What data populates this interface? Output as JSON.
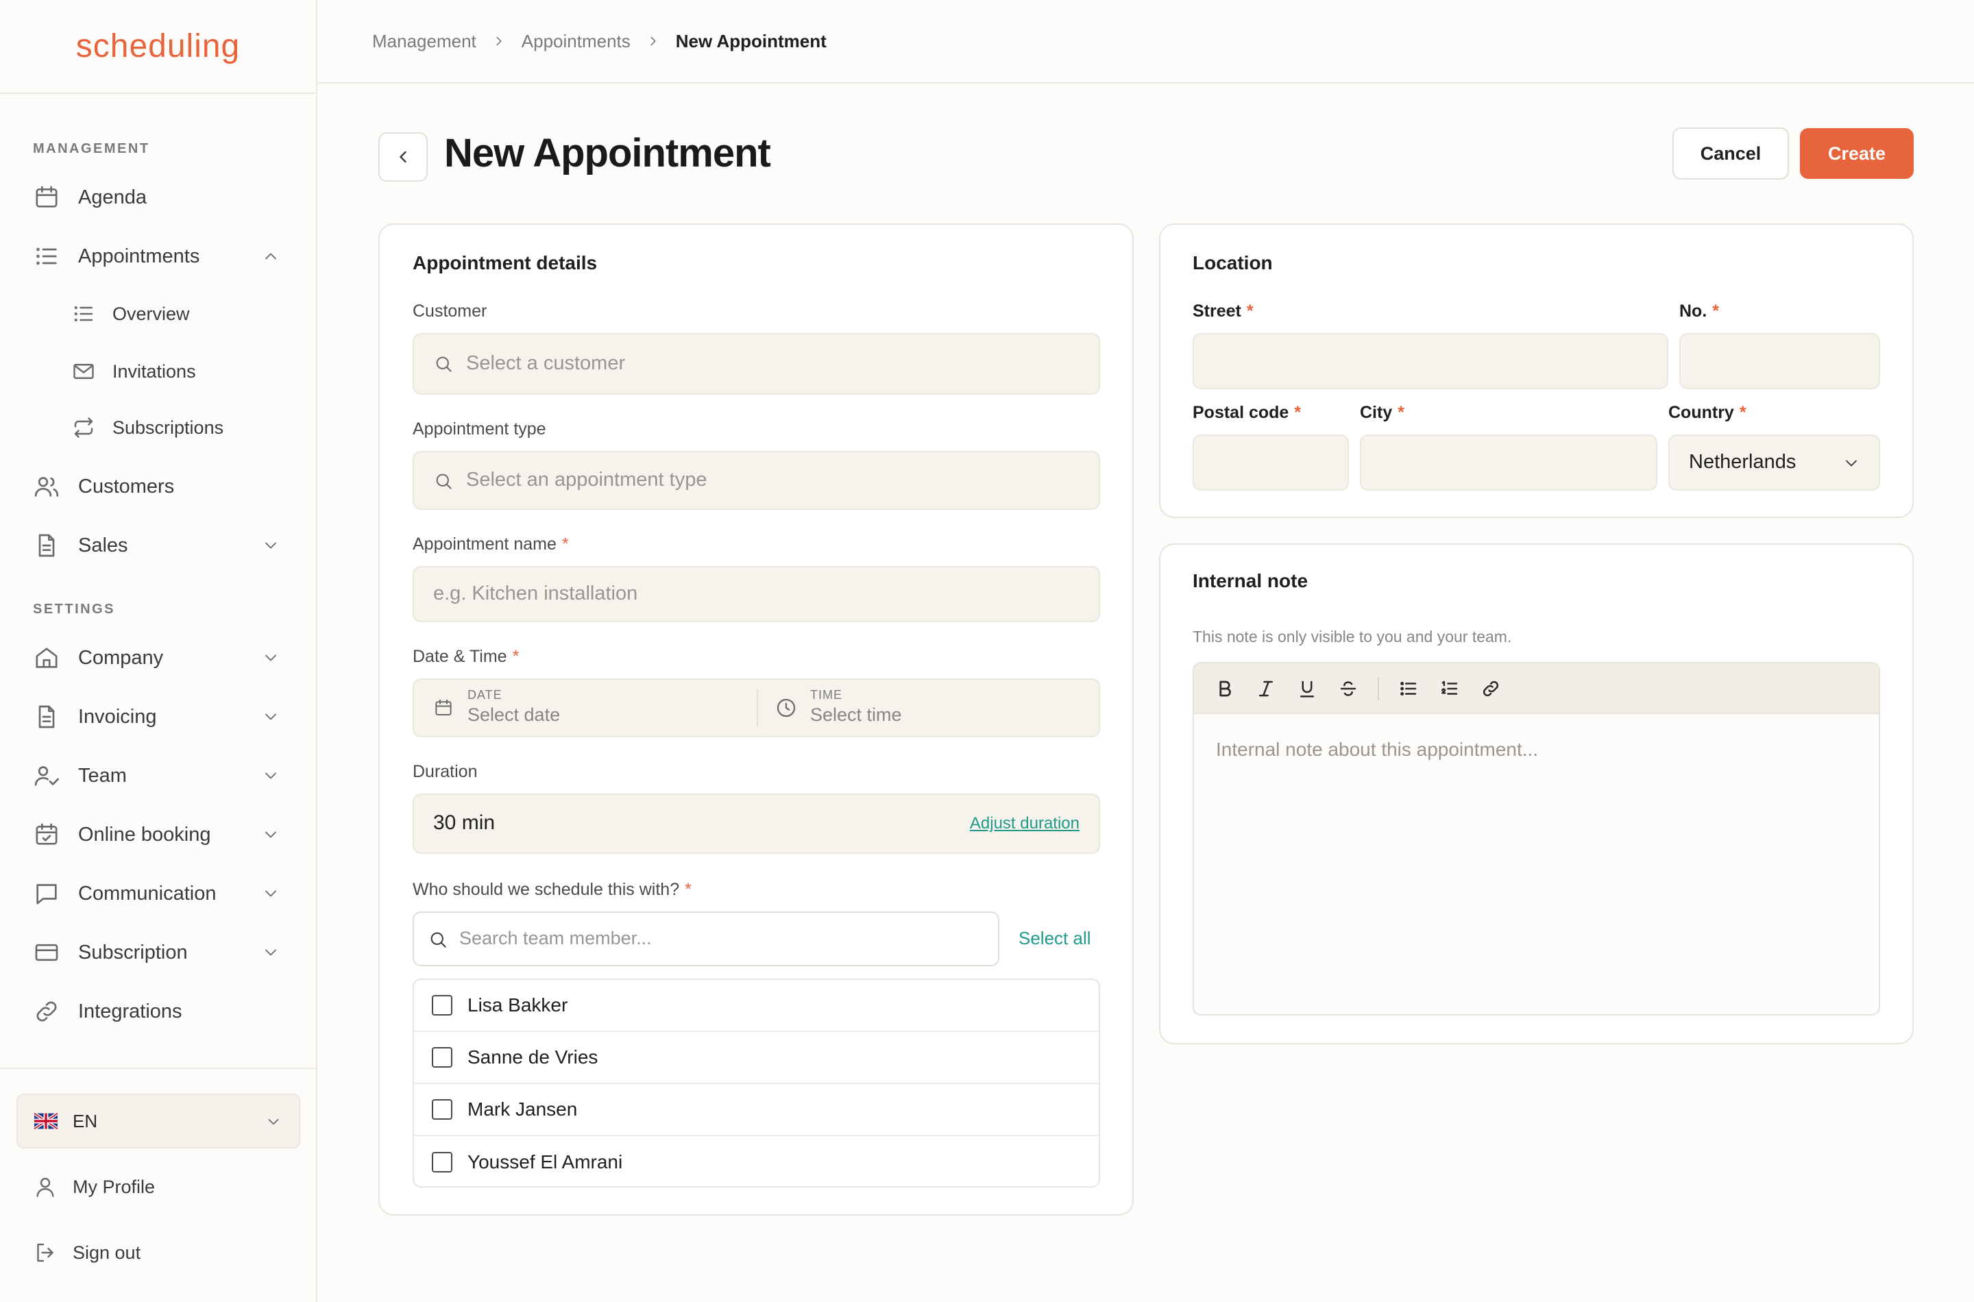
{
  "app": {
    "logo": "scheduling"
  },
  "sidebar": {
    "management_label": "MANAGEMENT",
    "settings_label": "SETTINGS",
    "items": {
      "agenda": "Agenda",
      "appointments": "Appointments",
      "overview": "Overview",
      "invitations": "Invitations",
      "subscriptions": "Subscriptions",
      "customers": "Customers",
      "sales": "Sales",
      "company": "Company",
      "invoicing": "Invoicing",
      "team": "Team",
      "online_booking": "Online booking",
      "communication": "Communication",
      "subscription": "Subscription",
      "integrations": "Integrations"
    },
    "language": "EN",
    "my_profile": "My Profile",
    "sign_out": "Sign out"
  },
  "breadcrumb": [
    "Management",
    "Appointments",
    "New Appointment"
  ],
  "header": {
    "title": "New Appointment",
    "cancel": "Cancel",
    "create": "Create"
  },
  "details": {
    "title": "Appointment details",
    "customer_label": "Customer",
    "customer_placeholder": "Select a customer",
    "type_label": "Appointment type",
    "type_placeholder": "Select an appointment type",
    "name_label": "Appointment name",
    "name_placeholder": "e.g. Kitchen installation",
    "datetime_label": "Date & Time",
    "date_caption": "DATE",
    "date_placeholder": "Select date",
    "time_caption": "TIME",
    "time_placeholder": "Select time",
    "duration_label": "Duration",
    "duration_value": "30 min",
    "adjust_duration": "Adjust duration",
    "schedule_with_label": "Who should we schedule this with?",
    "team_search_placeholder": "Search team member...",
    "select_all": "Select all",
    "members": [
      "Lisa Bakker",
      "Sanne de Vries",
      "Mark Jansen",
      "Youssef El Amrani"
    ],
    "required_mark": "*"
  },
  "location": {
    "title": "Location",
    "street_label": "Street",
    "number_label": "No.",
    "postal_label": "Postal code",
    "city_label": "City",
    "country_label": "Country",
    "country_value": "Netherlands"
  },
  "note": {
    "title": "Internal note",
    "helper": "This note is only visible to you and your team.",
    "placeholder": "Internal note about this appointment..."
  },
  "colors": {
    "accent": "#e8643c",
    "teal": "#1f9a8a"
  }
}
